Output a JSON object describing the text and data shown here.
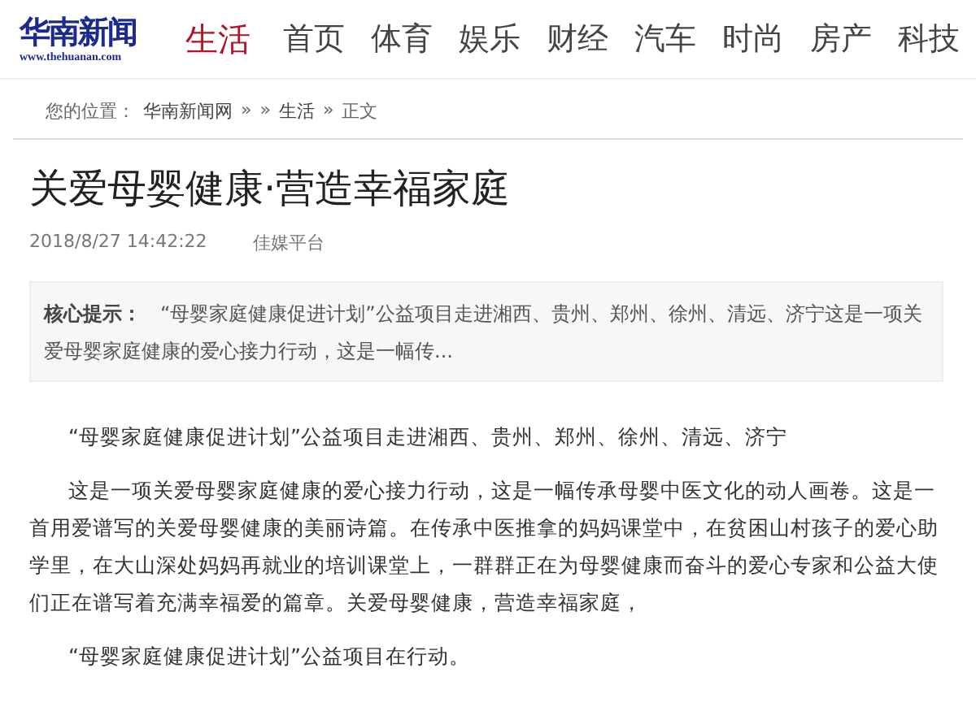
{
  "header": {
    "logo": {
      "name": "华南新闻",
      "url": "www.thehuanan.com"
    },
    "channel": "生活",
    "nav": [
      {
        "label": "首页",
        "selected": false
      },
      {
        "label": "体育",
        "selected": false
      },
      {
        "label": "娱乐",
        "selected": false
      },
      {
        "label": "财经",
        "selected": false
      },
      {
        "label": "汽车",
        "selected": false
      },
      {
        "label": "时尚",
        "selected": false
      },
      {
        "label": "房产",
        "selected": false
      },
      {
        "label": "科技",
        "selected": false
      }
    ]
  },
  "breadcrumb": {
    "label": "您的位置：",
    "items": [
      {
        "kind": "link",
        "text": "华南新闻网"
      },
      {
        "kind": "sep",
        "text": "»"
      },
      {
        "kind": "sep",
        "text": "»"
      },
      {
        "kind": "link",
        "text": "生活"
      },
      {
        "kind": "sep",
        "text": "»"
      },
      {
        "kind": "text",
        "text": "正文"
      }
    ]
  },
  "article": {
    "title": "关爱母婴健康·营造幸福家庭",
    "date": "2018/8/27 14:42:22",
    "source": "佳媒平台",
    "summary": {
      "label": "核心提示：",
      "text": "“母婴家庭健康促进计划”公益项目走进湘西、贵州、郑州、徐州、清远、济宁这是一项关爱母婴家庭健康的爱心接力行动，这是一幅传..."
    },
    "paragraphs": [
      "“母婴家庭健康促进计划”公益项目走进湘西、贵州、郑州、徐州、清远、济宁",
      "这是一项关爱母婴家庭健康的爱心接力行动，这是一幅传承母婴中医文化的动人画卷。这是一首用爱谱写的关爱母婴健康的美丽诗篇。在传承中医推拿的妈妈课堂中，在贫困山村孩子的爱心助学里，在大山深处妈妈再就业的培训课堂上，一群群正在为母婴健康而奋斗的爱心专家和公益大使们正在谱写着充满幸福爱的篇章。关爱母婴健康，营造幸福家庭，",
      "“母婴家庭健康促进计划”公益项目在行动。"
    ]
  }
}
